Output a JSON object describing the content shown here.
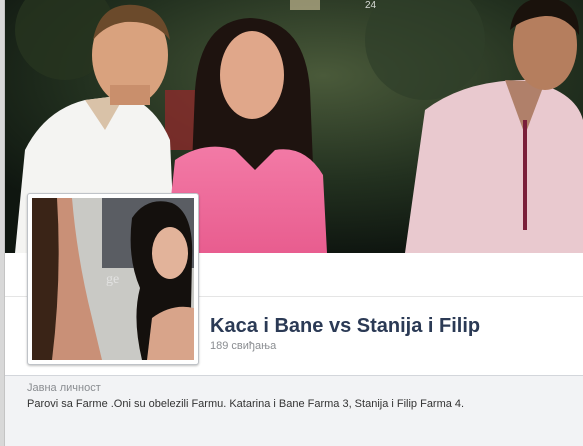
{
  "page": {
    "name": "Kaca i Bane vs Stanija i Filip",
    "likes": "189 свиђања"
  },
  "about": {
    "category": "Јавна личност",
    "description": "Parovi sa Farme .Oni su obelezili Farmu. Katarina i Bane Farma 3, Stanija i Filip Farma 4."
  },
  "colors": {
    "name_text": "#2b3a55",
    "muted_text": "#8a8d91",
    "header_background": "#ffffff",
    "about_background": "#f2f3f5"
  }
}
